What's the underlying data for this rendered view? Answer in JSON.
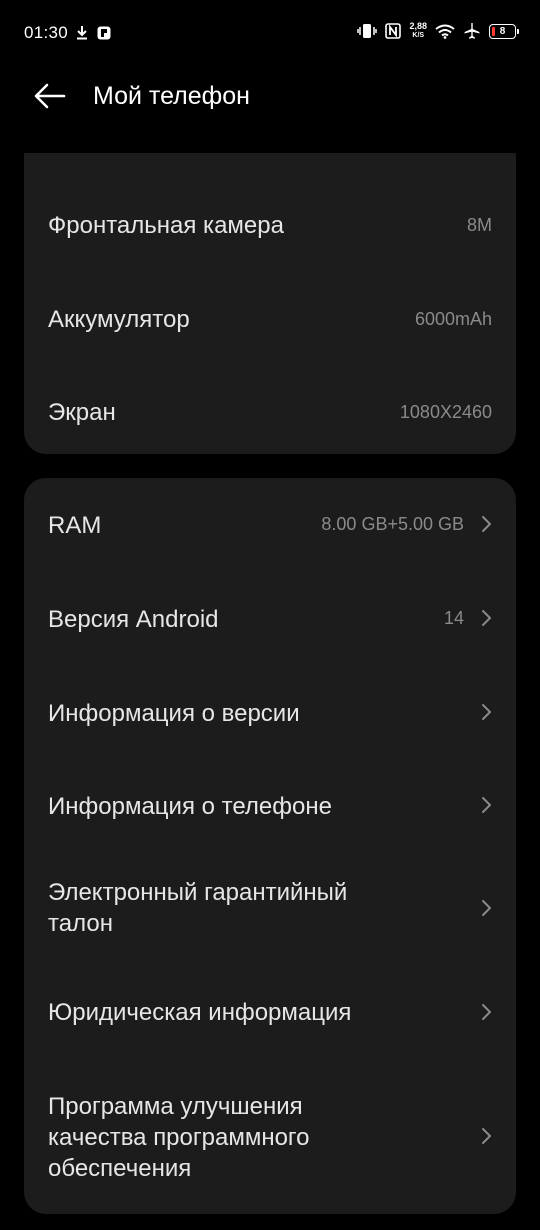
{
  "status_bar": {
    "time": "01:30",
    "speed_value": "2,88",
    "speed_unit": "K/S",
    "battery_level": "8",
    "left_icons": [
      "download-icon",
      "app-notification-icon"
    ],
    "right_icons": [
      "vibrate-icon",
      "nfc-icon",
      "wifi-icon",
      "airplane-icon"
    ],
    "battery_low_color": "#ff3b30"
  },
  "header": {
    "title": "Мой телефон"
  },
  "specs": [
    {
      "label": "Фронтальная камера",
      "value": "8M"
    },
    {
      "label": "Аккумулятор",
      "value": "6000mAh"
    },
    {
      "label": "Экран",
      "value": "1080X2460"
    }
  ],
  "menu": [
    {
      "label": "RAM",
      "value": "8.00 GB+5.00 GB"
    },
    {
      "label": "Версия Android",
      "value": "14"
    },
    {
      "label": "Информация о версии",
      "value": ""
    },
    {
      "label": "Информация о телефоне",
      "value": ""
    },
    {
      "label_line1": "Электронный гарантийный",
      "label_line2": "талон",
      "value": ""
    },
    {
      "label": "Юридическая информация",
      "value": ""
    },
    {
      "label_line1": "Программа улучшения",
      "label_line2": "качества программного",
      "label_line3": "обеспечения",
      "value": ""
    }
  ],
  "colors": {
    "background": "#000000",
    "card": "#1c1c1c",
    "text_primary": "#e6e6e6",
    "text_secondary": "#8a8a8a"
  }
}
